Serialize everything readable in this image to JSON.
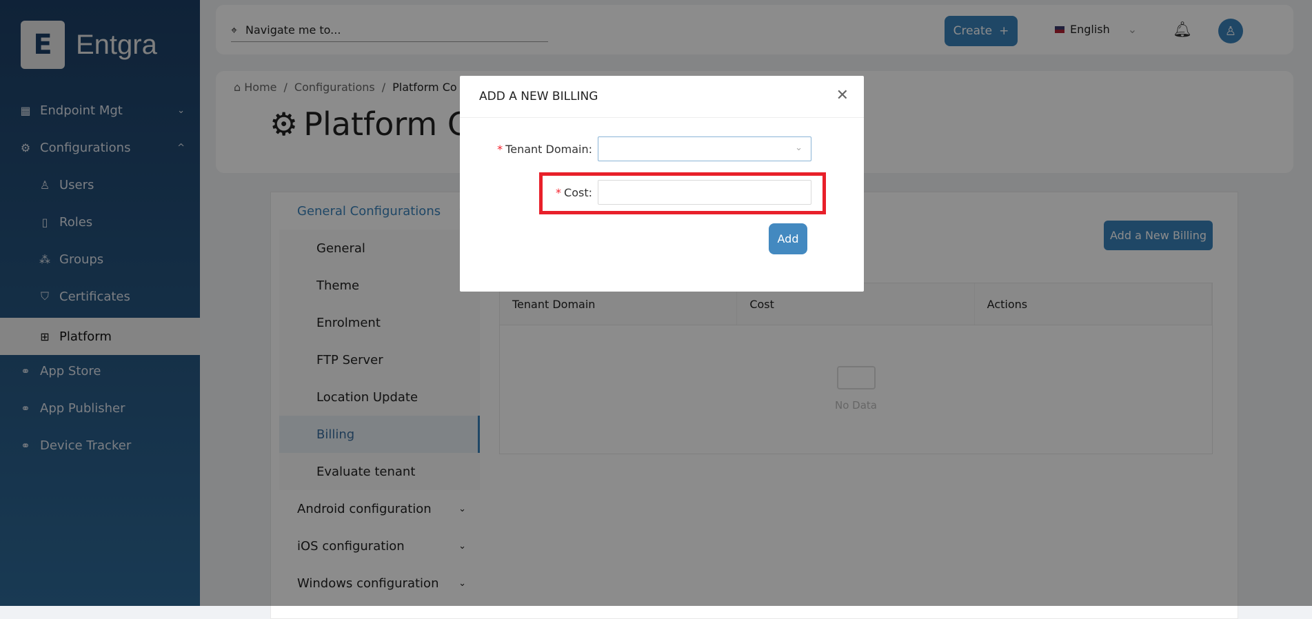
{
  "brand": {
    "name": "Entgra"
  },
  "sidebar": {
    "items": [
      {
        "label": "Endpoint Mgt",
        "icon": "grid-icon"
      },
      {
        "label": "Configurations",
        "icon": "gear-icon"
      },
      {
        "label": "Users",
        "icon": "user-icon"
      },
      {
        "label": "Roles",
        "icon": "book-icon"
      },
      {
        "label": "Groups",
        "icon": "cluster-icon"
      },
      {
        "label": "Certificates",
        "icon": "shield-icon"
      },
      {
        "label": "Platform",
        "icon": "sliders-icon"
      },
      {
        "label": "App Store",
        "icon": "link-icon"
      },
      {
        "label": "App Publisher",
        "icon": "link-icon"
      },
      {
        "label": "Device Tracker",
        "icon": "link-icon"
      }
    ]
  },
  "topbar": {
    "search_placeholder": "Navigate me to...",
    "create_label": "Create",
    "language": "English"
  },
  "breadcrumb": {
    "home": "Home",
    "sep": "/",
    "configurations": "Configurations",
    "current": "Platform Co"
  },
  "page_title": "Platform C",
  "config_menu": {
    "items": [
      {
        "label": "General Configurations"
      },
      {
        "label": "General"
      },
      {
        "label": "Theme"
      },
      {
        "label": "Enrolment"
      },
      {
        "label": "FTP Server"
      },
      {
        "label": "Location Update"
      },
      {
        "label": "Billing"
      },
      {
        "label": "Evaluate tenant"
      },
      {
        "label": "Android configuration"
      },
      {
        "label": "iOS configuration"
      },
      {
        "label": "Windows configuration"
      }
    ]
  },
  "billing": {
    "add_button": "Add a New Billing",
    "columns": [
      "Tenant Domain",
      "Cost",
      "Actions"
    ],
    "empty_text": "No Data"
  },
  "modal": {
    "title": "ADD A NEW BILLING",
    "tenant_label": "Tenant Domain",
    "tenant_value": "",
    "cost_label": "Cost",
    "cost_value": "",
    "add_label": "Add",
    "colon": ":",
    "required": "*"
  },
  "colors": {
    "accent": "#3a81ba",
    "highlight": "#e8202a"
  }
}
